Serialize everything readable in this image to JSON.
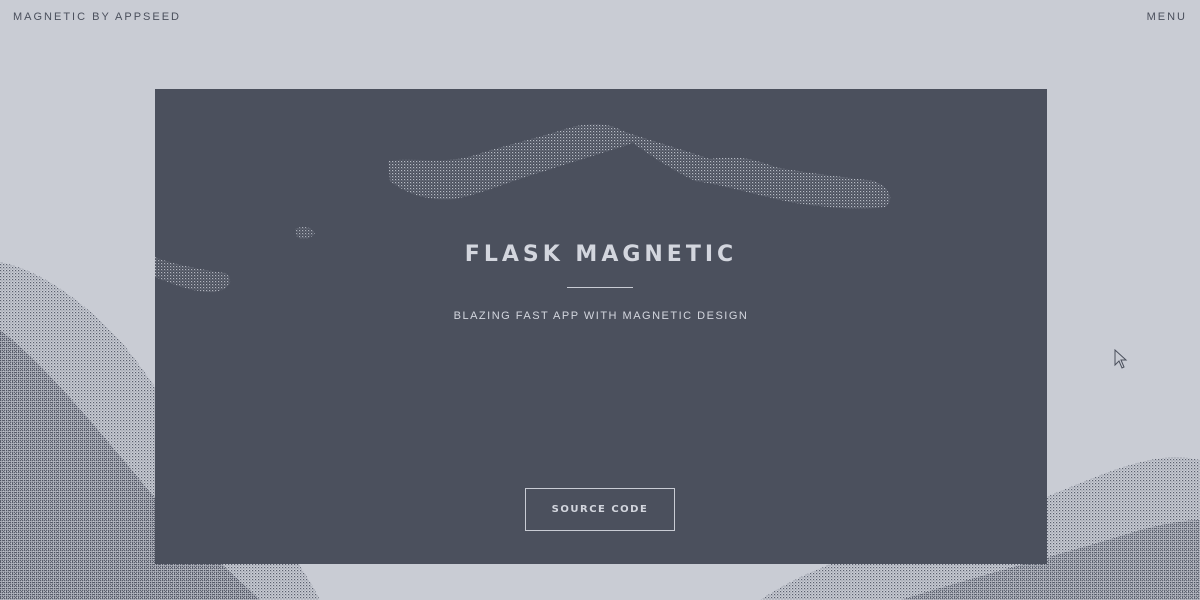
{
  "topbar": {
    "brand": "MAGNETIC BY APPSEED",
    "menu_label": "MENU"
  },
  "hero": {
    "title": "FLASK MAGNETIC",
    "subtitle": "BLAZING FAST APP WITH MAGNETIC DESIGN",
    "button_label": "SOURCE CODE"
  },
  "colors": {
    "page_background": "#c9ccd4",
    "panel_background": "#4b505d",
    "text_light": "#d3d6de",
    "text_dark": "#4a4f5c"
  },
  "icons": {
    "cursor": "mouse-pointer-icon"
  }
}
